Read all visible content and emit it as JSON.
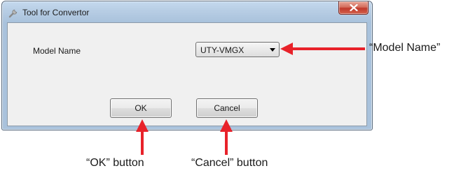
{
  "window": {
    "title": "Tool for Convertor",
    "title_icon": "wrench-icon",
    "close_icon": "close-icon"
  },
  "form": {
    "model_label": "Model Name",
    "model_value": "UTY-VMGX",
    "dropdown_icon": "triangle-down-icon"
  },
  "buttons": {
    "ok_label": "OK",
    "cancel_label": "Cancel"
  },
  "annotations": {
    "model_callout": "“Model Name”",
    "ok_callout": "“OK” button",
    "cancel_callout": "“Cancel” button",
    "arrow_color": "#e8222a"
  },
  "colors": {
    "titlebar": "#b7cde4",
    "close_button": "#c0392b",
    "client_bg": "#f0f0f0"
  }
}
